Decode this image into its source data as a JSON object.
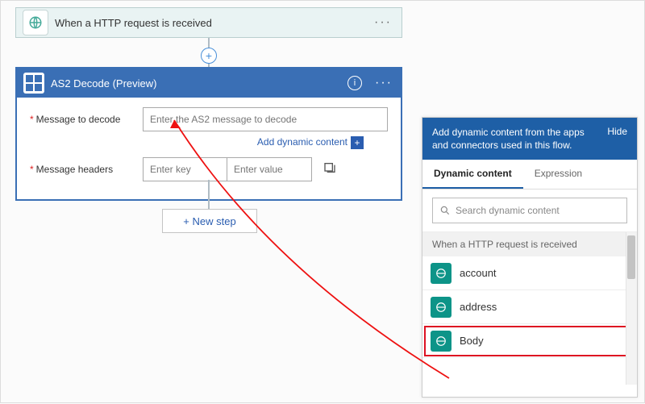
{
  "trigger": {
    "title": "When a HTTP request is received"
  },
  "action": {
    "title": "AS2 Decode  (Preview)",
    "fields": {
      "message_label": "Message to decode",
      "message_placeholder": "Enter the AS2 message to decode",
      "headers_label": "Message headers",
      "key_placeholder": "Enter key",
      "value_placeholder": "Enter value"
    },
    "add_dynamic": "Add dynamic content"
  },
  "new_step": "+ New step",
  "dyn_panel": {
    "header": "Add dynamic content from the apps and connectors used in this flow.",
    "hide": "Hide",
    "tabs": {
      "dynamic": "Dynamic content",
      "expression": "Expression"
    },
    "search_placeholder": "Search dynamic content",
    "group": "When a HTTP request is received",
    "tokens": [
      "account",
      "address",
      "Body"
    ]
  }
}
